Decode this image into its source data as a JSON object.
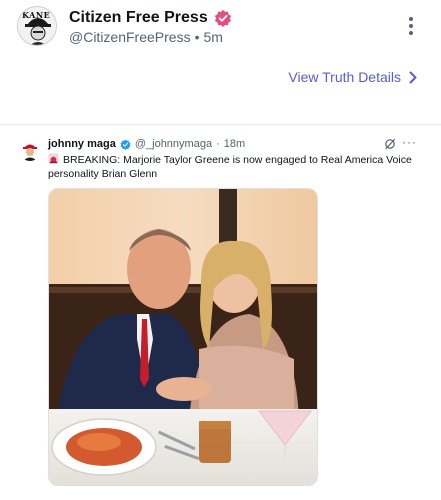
{
  "post": {
    "display_name": "Citizen Free Press",
    "handle": "@CitizenFreePress",
    "separator": "•",
    "time": "5m",
    "avatar_text": "KANE"
  },
  "details_link": {
    "label": "View Truth Details"
  },
  "embed": {
    "name": "johnny maga",
    "handle": "@_johnnymaga",
    "separator": "·",
    "time": "18m",
    "more": "···",
    "text": "BREAKING: Marjorie Taylor Greene is now engaged to Real America Voice personality Brian Glenn",
    "photo_alt": "Couple embracing at a restaurant table"
  },
  "colors": {
    "accent": "#5b5bd6",
    "verified_pink": "#e2507f",
    "verified_blue": "#1d9bf0"
  },
  "icons": [
    "more-vertical-icon",
    "chevron-right-icon",
    "verified-icon",
    "grok-icon",
    "siren-icon"
  ]
}
